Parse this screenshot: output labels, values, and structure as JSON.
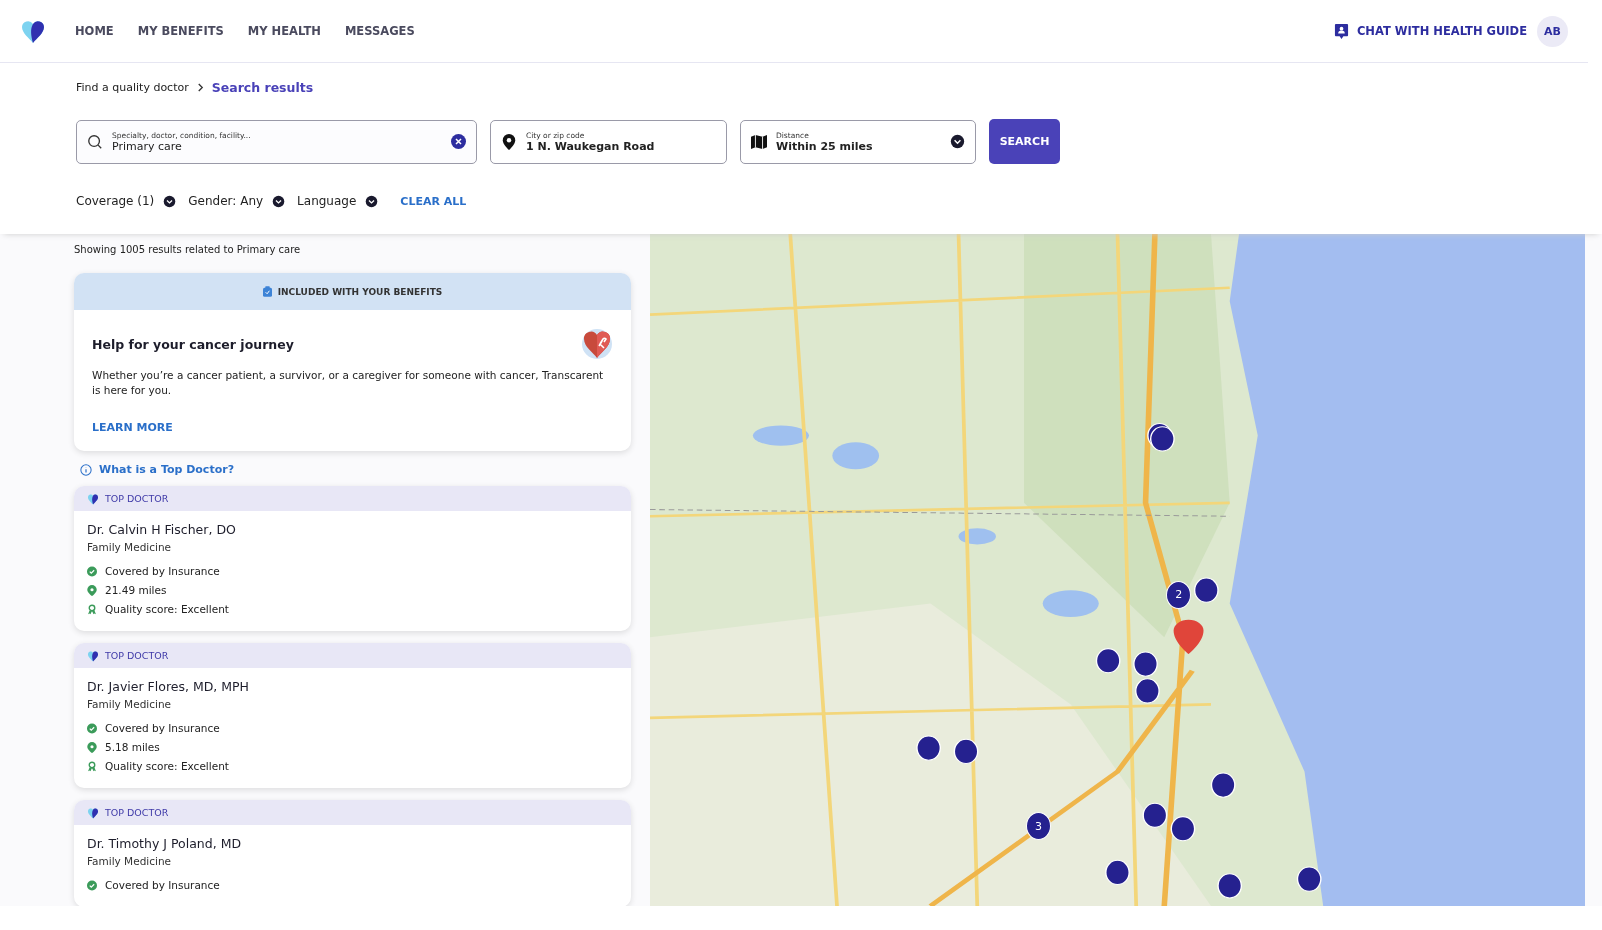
{
  "nav": {
    "items": [
      {
        "label": "HOME"
      },
      {
        "label": "MY BENEFITS"
      },
      {
        "label": "MY HEALTH"
      },
      {
        "label": "MESSAGES"
      }
    ],
    "chat": "CHAT WITH HEALTH GUIDE",
    "avatar": "AB"
  },
  "breadcrumb": {
    "parent": "Find a quality doctor",
    "current": "Search results"
  },
  "search": {
    "query_label": "Specialty, doctor, condition, facility...",
    "query": "Primary care",
    "location_label": "City or zip code",
    "location": "1 N. Waukegan Road",
    "distance_label": "Distance",
    "distance": "Within 25 miles",
    "button": "SEARCH"
  },
  "filters": [
    {
      "label": "Coverage (1)"
    },
    {
      "label": "Gender: Any"
    },
    {
      "label": "Language"
    }
  ],
  "clear_all": "CLEAR ALL",
  "results_summary": "Showing 1005 results related to Primary care",
  "promo": {
    "banner": "INCLUDED WITH YOUR BENEFITS",
    "title": "Help for your cancer journey",
    "body": "Whether you’re a cancer patient, a survivor, or a caregiver for someone with cancer, Transcarent is here for you.",
    "link": "LEARN MORE"
  },
  "top_doctor_link": "What is a Top Doctor?",
  "doctors": [
    {
      "badge": "TOP DOCTOR",
      "name": "Dr. Calvin H Fischer, DO",
      "specialty": "Family Medicine",
      "details": [
        {
          "kind": "coverage",
          "text": "Covered by Insurance"
        },
        {
          "kind": "distance",
          "text": "21.49 miles"
        },
        {
          "kind": "quality",
          "text": "Quality score: Excellent"
        }
      ]
    },
    {
      "badge": "TOP DOCTOR",
      "name": "Dr. Javier Flores, MD, MPH",
      "specialty": "Family Medicine",
      "details": [
        {
          "kind": "coverage",
          "text": "Covered by Insurance"
        },
        {
          "kind": "distance",
          "text": "5.18 miles"
        },
        {
          "kind": "quality",
          "text": "Quality score: Excellent"
        }
      ]
    },
    {
      "badge": "TOP DOCTOR",
      "name": "Dr. Timothy J Poland, MD",
      "specialty": "Family Medicine",
      "details": [
        {
          "kind": "coverage",
          "text": "Covered by Insurance"
        }
      ]
    }
  ],
  "map": {
    "kind": "picture",
    "clusters": [
      {
        "label": "2"
      },
      {
        "label": "3"
      }
    ]
  }
}
